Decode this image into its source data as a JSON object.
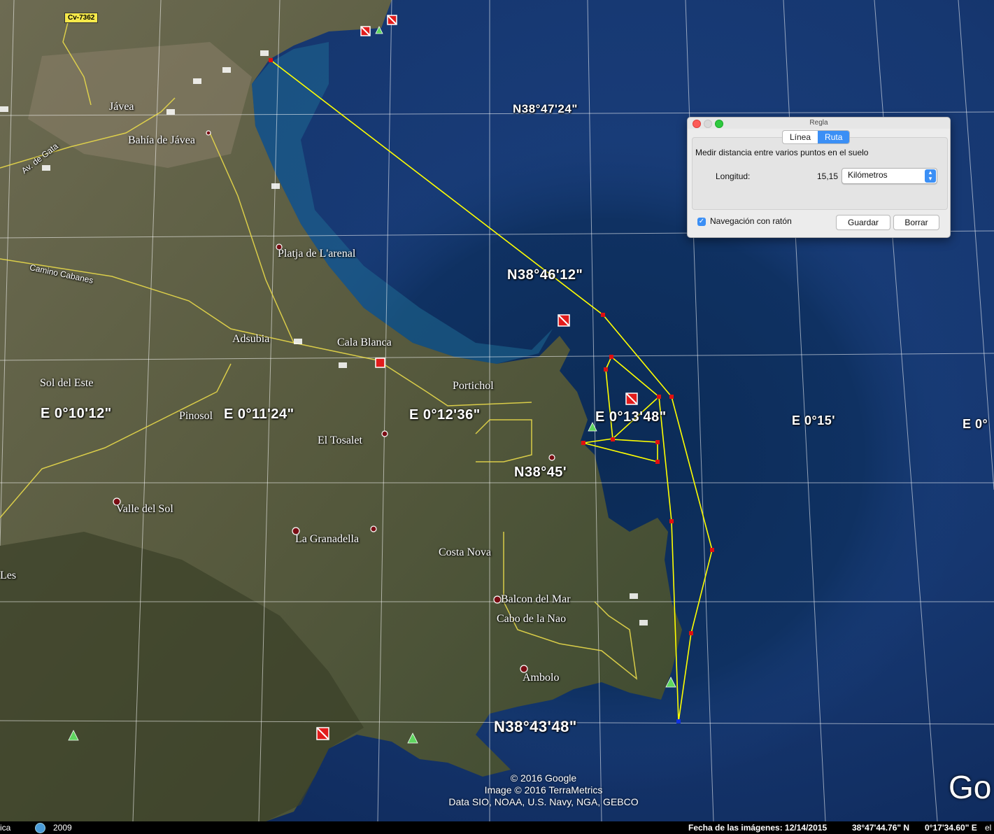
{
  "map": {
    "places": [
      "Jávea",
      "Bahía de Jávea",
      "Platja de L'arenal",
      "Adsubia",
      "Cala Blanca",
      "Sol del Este",
      "Portichol",
      "Pinosol",
      "El Tosalet",
      "Valle del Sol",
      "La Granadella",
      "Costa Nova",
      "Balcon del Mar",
      "Cabo de la Nao",
      "Ambolo",
      "Camino Cabanes",
      "Av. de Gata",
      "Les"
    ],
    "road_badge": "Cv-7362",
    "grid_labels": [
      "N38°47'24\"",
      "N38°46'12\"",
      "N38°45'",
      "N38°43'48\"",
      "E 0°10'12\"",
      "E 0°11'24\"",
      "E 0°12'36\"",
      "E 0°13'48\"",
      "E 0°15'",
      "E 0°"
    ],
    "attribution": [
      "© 2016 Google",
      "Image © 2016 TerraMetrics",
      "Data SIO, NOAA, U.S. Navy, NGA, GEBCO"
    ],
    "logo": "Go"
  },
  "status_bar": {
    "left_text": "ica",
    "year": "2009",
    "imagery_date": "Fecha de las imágenes: 12/14/2015",
    "lat": "38°47'44.76\" N",
    "lon": "0°17'34.60\" E",
    "extra": "el"
  },
  "dialog": {
    "title": "Regla",
    "tabs": [
      "Línea",
      "Ruta"
    ],
    "active_tab": "Ruta",
    "description": "Medir distancia entre varios puntos en el suelo",
    "length_label": "Longitud:",
    "length_value": "15,15",
    "unit": "Kilómetros",
    "mouse_nav_label": "Navegación con ratón",
    "mouse_nav_checked": true,
    "save_label": "Guardar",
    "clear_label": "Borrar"
  },
  "colors": {
    "route": "#ffff00",
    "vertex": "#e01010",
    "accent": "#3b8ff5"
  }
}
